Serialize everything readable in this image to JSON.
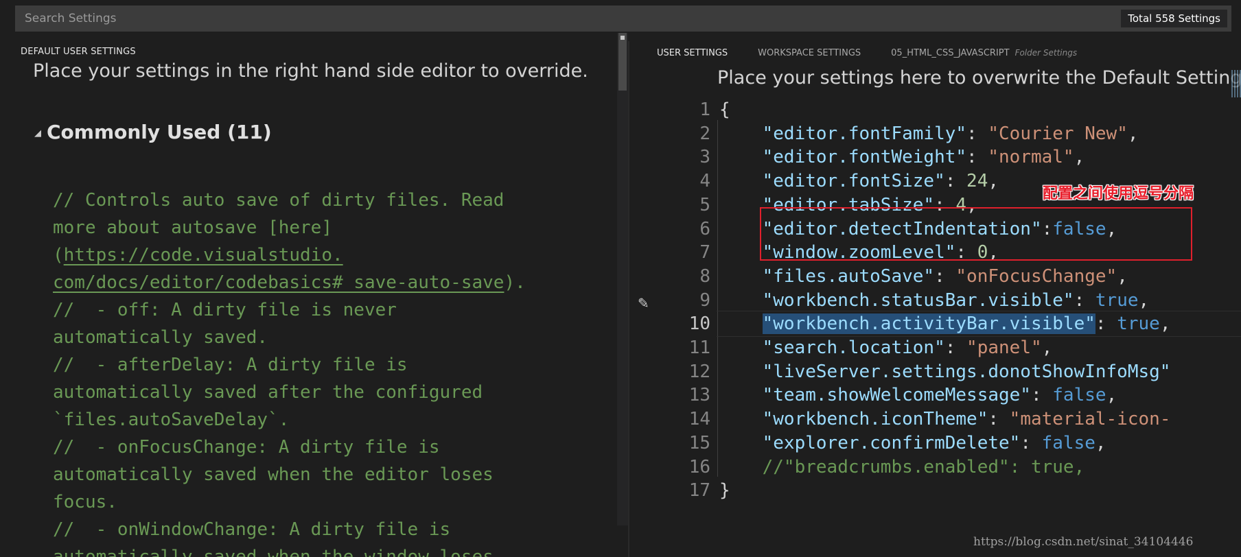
{
  "search": {
    "placeholder": "Search Settings",
    "count_label": "Total 558 Settings"
  },
  "left": {
    "header": "DEFAULT USER SETTINGS",
    "info": "Place your settings in the right hand side editor to override.",
    "section_label": "Commonly Used (11)",
    "comment_lines": [
      {
        "pre": "// Controls auto save of dirty files. Read",
        "link": "",
        "post": ""
      },
      {
        "pre": "more about autosave [here]",
        "link": "",
        "post": ""
      },
      {
        "pre": "(",
        "link": "https://code.visualstudio.",
        "post": ""
      },
      {
        "pre": "",
        "link": "com/docs/editor/codebasics#_save-auto-save",
        "post": ")."
      },
      {
        "pre": "//  - off: A dirty file is never",
        "link": "",
        "post": ""
      },
      {
        "pre": "automatically saved.",
        "link": "",
        "post": ""
      },
      {
        "pre": "//  - afterDelay: A dirty file is",
        "link": "",
        "post": ""
      },
      {
        "pre": "automatically saved after the configured",
        "link": "",
        "post": ""
      },
      {
        "pre": "`files.autoSaveDelay`.",
        "link": "",
        "post": ""
      },
      {
        "pre": "//  - onFocusChange: A dirty file is",
        "link": "",
        "post": ""
      },
      {
        "pre": "automatically saved when the editor loses",
        "link": "",
        "post": ""
      },
      {
        "pre": "focus.",
        "link": "",
        "post": ""
      },
      {
        "pre": "//  - onWindowChange: A dirty file is",
        "link": "",
        "post": ""
      },
      {
        "pre": "automatically saved when the window loses",
        "link": "",
        "post": ""
      }
    ]
  },
  "right": {
    "tabs": [
      {
        "label": "USER SETTINGS",
        "sub": "",
        "active": true
      },
      {
        "label": "WORKSPACE SETTINGS",
        "sub": "",
        "active": false
      },
      {
        "label": "05_HTML_CSS_JAVASCRIPT",
        "sub": "Folder Settings",
        "active": false
      }
    ],
    "info": "Place your settings here to overwrite the Default Settings.",
    "current_line": 10,
    "code_lines": [
      {
        "num": "1",
        "tokens": [
          {
            "t": "p",
            "v": "{"
          }
        ]
      },
      {
        "num": "2",
        "tokens": [
          {
            "t": "p",
            "v": "    "
          },
          {
            "t": "k",
            "v": "\"editor.fontFamily\""
          },
          {
            "t": "p",
            "v": ": "
          },
          {
            "t": "s",
            "v": "\"Courier New\""
          },
          {
            "t": "p",
            "v": ","
          }
        ]
      },
      {
        "num": "3",
        "tokens": [
          {
            "t": "p",
            "v": "    "
          },
          {
            "t": "k",
            "v": "\"editor.fontWeight\""
          },
          {
            "t": "p",
            "v": ": "
          },
          {
            "t": "s",
            "v": "\"normal\""
          },
          {
            "t": "p",
            "v": ","
          }
        ]
      },
      {
        "num": "4",
        "tokens": [
          {
            "t": "p",
            "v": "    "
          },
          {
            "t": "k",
            "v": "\"editor.fontSize\""
          },
          {
            "t": "p",
            "v": ": "
          },
          {
            "t": "n",
            "v": "24"
          },
          {
            "t": "p",
            "v": ","
          }
        ]
      },
      {
        "num": "5",
        "tokens": [
          {
            "t": "p",
            "v": "    "
          },
          {
            "t": "k",
            "v": "\"editor.tabSize\""
          },
          {
            "t": "p",
            "v": ": "
          },
          {
            "t": "n",
            "v": "4"
          },
          {
            "t": "p",
            "v": ","
          }
        ]
      },
      {
        "num": "6",
        "tokens": [
          {
            "t": "p",
            "v": "    "
          },
          {
            "t": "k",
            "v": "\"editor.detectIndentation\""
          },
          {
            "t": "p",
            "v": ":"
          },
          {
            "t": "b",
            "v": "false"
          },
          {
            "t": "p",
            "v": ","
          }
        ]
      },
      {
        "num": "7",
        "tokens": [
          {
            "t": "p",
            "v": "    "
          },
          {
            "t": "k",
            "v": "\"window.zoomLevel\""
          },
          {
            "t": "p",
            "v": ": "
          },
          {
            "t": "n",
            "v": "0"
          },
          {
            "t": "p",
            "v": ","
          }
        ]
      },
      {
        "num": "8",
        "tokens": [
          {
            "t": "p",
            "v": "    "
          },
          {
            "t": "k",
            "v": "\"files.autoSave\""
          },
          {
            "t": "p",
            "v": ": "
          },
          {
            "t": "s",
            "v": "\"onFocusChange\""
          },
          {
            "t": "p",
            "v": ","
          }
        ]
      },
      {
        "num": "9",
        "tokens": [
          {
            "t": "p",
            "v": "    "
          },
          {
            "t": "k",
            "v": "\"workbench.statusBar.visible\""
          },
          {
            "t": "p",
            "v": ": "
          },
          {
            "t": "b",
            "v": "true"
          },
          {
            "t": "p",
            "v": ","
          }
        ]
      },
      {
        "num": "10",
        "tokens": [
          {
            "t": "p",
            "v": "    "
          },
          {
            "t": "k hl",
            "v": "\"workbench.activityBar.visible\""
          },
          {
            "t": "p",
            "v": ": "
          },
          {
            "t": "b",
            "v": "true"
          },
          {
            "t": "p",
            "v": ","
          }
        ]
      },
      {
        "num": "11",
        "tokens": [
          {
            "t": "p",
            "v": "    "
          },
          {
            "t": "k",
            "v": "\"search.location\""
          },
          {
            "t": "p",
            "v": ": "
          },
          {
            "t": "s",
            "v": "\"panel\""
          },
          {
            "t": "p",
            "v": ","
          }
        ]
      },
      {
        "num": "12",
        "tokens": [
          {
            "t": "p",
            "v": "    "
          },
          {
            "t": "k",
            "v": "\"liveServer.settings.donotShowInfoMsg\""
          }
        ]
      },
      {
        "num": "13",
        "tokens": [
          {
            "t": "p",
            "v": "    "
          },
          {
            "t": "k",
            "v": "\"team.showWelcomeMessage\""
          },
          {
            "t": "p",
            "v": ": "
          },
          {
            "t": "b",
            "v": "false"
          },
          {
            "t": "p",
            "v": ","
          }
        ]
      },
      {
        "num": "14",
        "tokens": [
          {
            "t": "p",
            "v": "    "
          },
          {
            "t": "k",
            "v": "\"workbench.iconTheme\""
          },
          {
            "t": "p",
            "v": ": "
          },
          {
            "t": "s",
            "v": "\"material-icon-"
          }
        ]
      },
      {
        "num": "15",
        "tokens": [
          {
            "t": "p",
            "v": "    "
          },
          {
            "t": "k",
            "v": "\"explorer.confirmDelete\""
          },
          {
            "t": "p",
            "v": ": "
          },
          {
            "t": "b",
            "v": "false"
          },
          {
            "t": "p",
            "v": ","
          }
        ]
      },
      {
        "num": "16",
        "tokens": [
          {
            "t": "p",
            "v": "    "
          },
          {
            "t": "c",
            "v": "//\"breadcrumbs.enabled\": true,"
          }
        ]
      },
      {
        "num": "17",
        "tokens": [
          {
            "t": "p",
            "v": "}"
          }
        ]
      }
    ],
    "annotation": "配置之间使用逗号分隔"
  },
  "watermark": "https://blog.csdn.net/sinat_34104446",
  "icons": {
    "section_toggle": "triangle-down-icon",
    "edit": "pencil-icon"
  },
  "colors": {
    "background": "#1e1e1e",
    "key": "#9cdcfe",
    "string": "#ce9178",
    "number": "#b5cea8",
    "boolean": "#569cd6",
    "comment": "#6a9955",
    "annotation": "#e0202c"
  }
}
